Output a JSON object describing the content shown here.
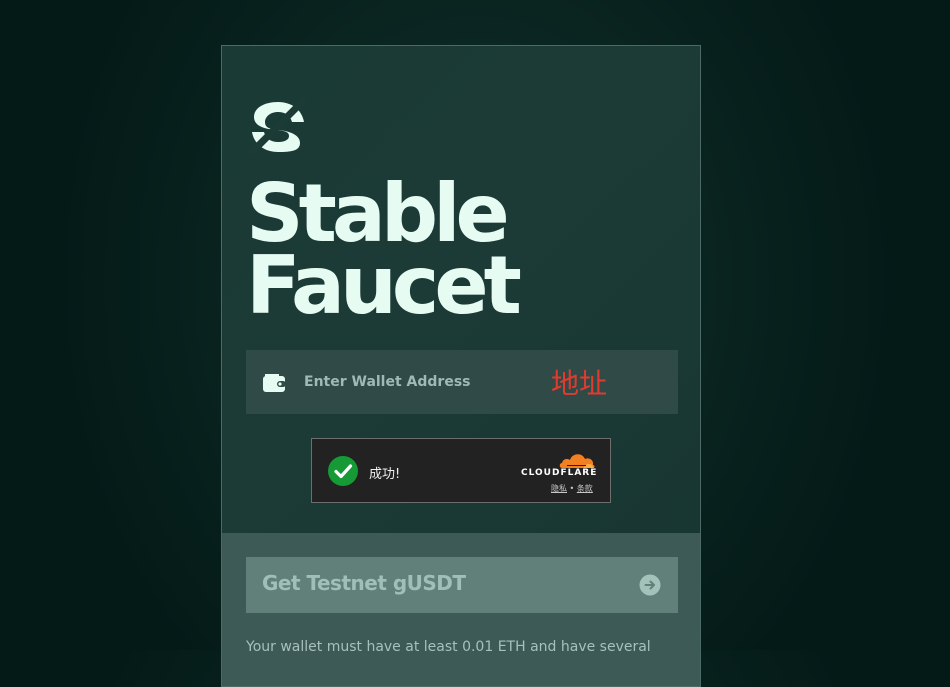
{
  "brand": {
    "title_line1": "Stable",
    "title_line2": "Faucet"
  },
  "wallet": {
    "placeholder": "Enter Wallet Address",
    "annotation": "地址"
  },
  "captcha": {
    "status": "成功!",
    "provider": "CLOUDFLARE",
    "privacy_link": "隐私",
    "separator": "•",
    "terms_link": "条款"
  },
  "action": {
    "button_label": "Get Testnet gUSDT"
  },
  "info": {
    "note": "Your wallet must have at least 0.01 ETH and have several"
  },
  "icons": {
    "logo": "stable-logo-icon",
    "wallet": "wallet-icon",
    "check": "checkmark-icon",
    "cloud": "cloudflare-cloud-icon",
    "arrow": "arrow-right-icon"
  },
  "colors": {
    "background": "#0a2420",
    "card": "#1c3b37",
    "title": "#e6fbf2",
    "input_bg": "#2f4a47",
    "button_bg": "#608079",
    "success_green": "#159a35",
    "cloudflare_orange": "#f38020",
    "annotation_red": "#e23b2e"
  }
}
